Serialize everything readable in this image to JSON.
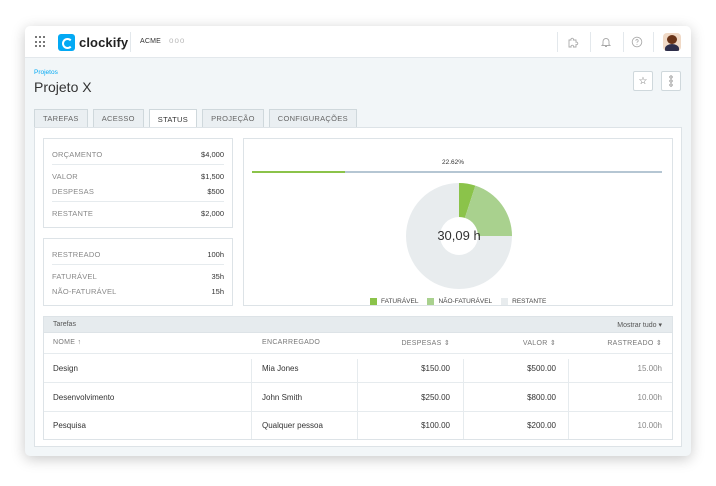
{
  "app": {
    "logo_text": "clockify",
    "workspace": "ACME",
    "workspace_more": "ooo"
  },
  "breadcrumb": "Projetos",
  "page_title": "Projeto X",
  "tabs": [
    {
      "label": "TAREFAS"
    },
    {
      "label": "ACESSO"
    },
    {
      "label": "STATUS",
      "active": true
    },
    {
      "label": "PROJEÇÃO"
    },
    {
      "label": "CONFIGURAÇÕES"
    }
  ],
  "budget": {
    "orcamento": {
      "label": "ORÇAMENTO",
      "value": "$4,000"
    },
    "valor": {
      "label": "VALOR",
      "value": "$1,500"
    },
    "despesas": {
      "label": "DESPESAS",
      "value": "$500"
    },
    "restante": {
      "label": "RESTANTE",
      "value": "$2,000"
    }
  },
  "hours": {
    "rastreado": {
      "label": "RESTREADO",
      "value": "100h"
    },
    "faturavel": {
      "label": "FATURÁVEL",
      "value": "35h"
    },
    "nao_faturavel": {
      "label": "NÃO-FATURÁVEL",
      "value": "15h"
    }
  },
  "progress": {
    "label": "22.62%",
    "fraction": 0.2262
  },
  "donut": {
    "center_label": "30,09 h",
    "segments": [
      {
        "name": "FATURÁVEL",
        "value": 0.05,
        "color": "#8bc34a"
      },
      {
        "name": "NÃO-FATURÁVEL",
        "value": 0.2,
        "color": "#a9d18e"
      },
      {
        "name": "RESTANTE",
        "value": 0.75,
        "color": "#e8ecee"
      }
    ]
  },
  "legend": [
    "FATURÁVEL",
    "NÃO-FATURÁVEL",
    "RESTANTE"
  ],
  "tasks": {
    "title": "Tarefas",
    "show_all": "Mostrar tudo ▾",
    "columns": [
      "NOME ↑",
      "ENCARREGADO",
      "DESPESAS ⇕",
      "VALOR ⇕",
      "RASTREADO ⇕"
    ],
    "rows": [
      {
        "name": "Design",
        "assignee": "Mia Jones",
        "expenses": "$150.00",
        "value": "$500.00",
        "tracked": "15.00h"
      },
      {
        "name": "Desenvolvimento",
        "assignee": "John Smith",
        "expenses": "$250.00",
        "value": "$800.00",
        "tracked": "10.00h"
      },
      {
        "name": "Pesquisa",
        "assignee": "Qualquer pessoa",
        "expenses": "$100.00",
        "value": "$200.00",
        "tracked": "10.00h"
      }
    ]
  },
  "colors": {
    "accent": "#03a9f4",
    "billable": "#8bc34a",
    "non_billable": "#a9d18e",
    "remaining": "#e8ecee"
  },
  "icons": [
    "apps-grid-icon",
    "puzzle-icon",
    "bell-icon",
    "help-icon",
    "star-icon",
    "more-vertical-icon"
  ]
}
